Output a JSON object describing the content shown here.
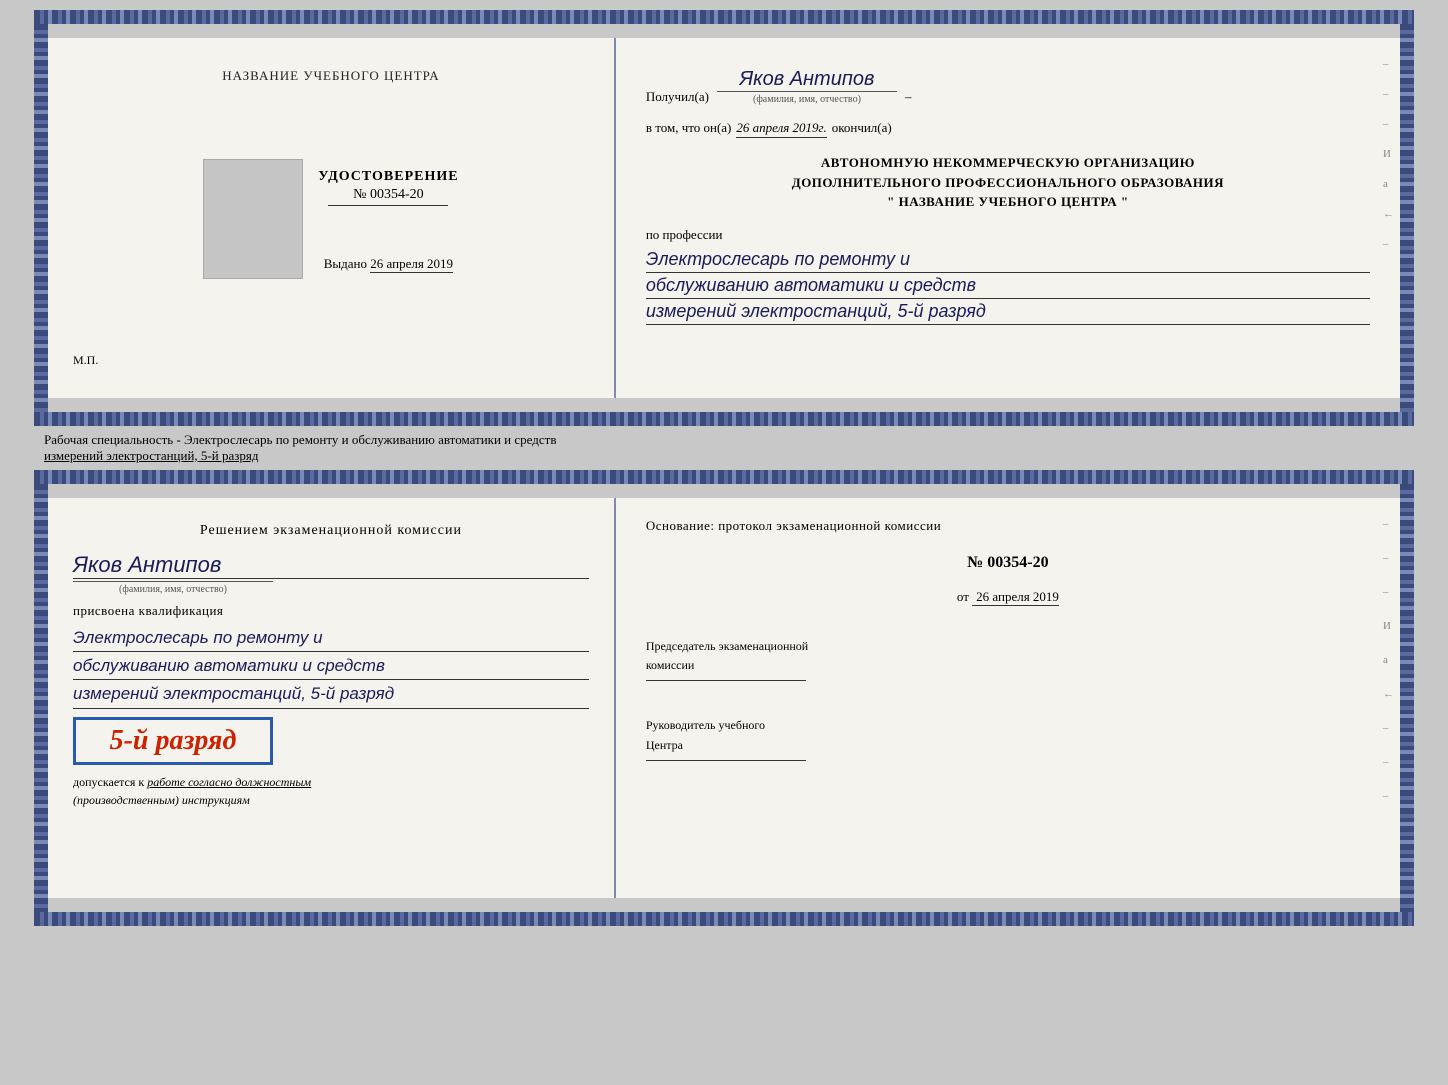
{
  "page": {
    "background_color": "#c8c8c8"
  },
  "top_cert": {
    "left": {
      "center_title": "НАЗВАНИЕ УЧЕБНОГО ЦЕНТРА",
      "udostoverenie": "УДОСТОВЕРЕНИЕ",
      "number_label": "№ 00354-20",
      "vydano_label": "Выдано",
      "vydano_date": "26 апреля 2019",
      "mp_label": "М.П."
    },
    "right": {
      "poluchil_label": "Получил(а)",
      "recipient_name": "Яков Антипов",
      "fio_label": "(фамилия, имя, отчество)",
      "v_tom_prefix": "в том, что он(а)",
      "v_tom_date": "26 апреля 2019г.",
      "okonchil": "окончил(а)",
      "org_line1": "АВТОНОМНУЮ НЕКОММЕРЧЕСКУЮ ОРГАНИЗАЦИЮ",
      "org_line2": "ДОПОЛНИТЕЛЬНОГО ПРОФЕССИОНАЛЬНОГО ОБРАЗОВАНИЯ",
      "org_line3": "\"   НАЗВАНИЕ УЧЕБНОГО ЦЕНТРА   \"",
      "po_professii": "по профессии",
      "profession_line1": "Электрослесарь по ремонту и",
      "profession_line2": "обслуживанию автоматики и средств",
      "profession_line3": "измерений электростанций, 5-й разряд",
      "deco1": "–",
      "deco2": "–",
      "deco3": "–",
      "deco4": "И",
      "deco5": "а",
      "deco6": "←",
      "deco7": "–"
    }
  },
  "middle_text": {
    "line1": "Рабочая специальность - Электрослесарь по ремонту и обслуживанию автоматики и средств",
    "line2": "измерений электростанций, 5-й разряд"
  },
  "bottom_cert": {
    "left": {
      "komissia_title": "Решением экзаменационной комиссии",
      "person_name": "Яков Антипов",
      "fio_label": "(фамилия, имя, отчество)",
      "prisvoena": "присвоена квалификация",
      "kvalif_line1": "Электрослесарь по ремонту и",
      "kvalif_line2": "обслуживанию автоматики и средств",
      "kvalif_line3": "измерений электростанций, 5-й разряд",
      "razryad_text": "5-й разряд",
      "dopuskaetsya_prefix": "допускается к",
      "dopuskaetsya_italic": "работе согласно должностным",
      "dopuskaetsya_italic2": "(производственным) инструкциям"
    },
    "right": {
      "osnovaniye": "Основание: протокол экзаменационной  комиссии",
      "number_label": "№  00354-20",
      "ot_label": "от",
      "ot_date": "26 апреля 2019",
      "predsedatel_label": "Председатель экзаменационной",
      "komissia_label": "комиссии",
      "rukovoditel_label": "Руководитель учебного",
      "tsentra_label": "Центра",
      "deco1": "–",
      "deco2": "–",
      "deco3": "–",
      "deco4": "И",
      "deco5": "а",
      "deco6": "←",
      "deco7": "–",
      "deco8": "–",
      "deco9": "–"
    }
  }
}
